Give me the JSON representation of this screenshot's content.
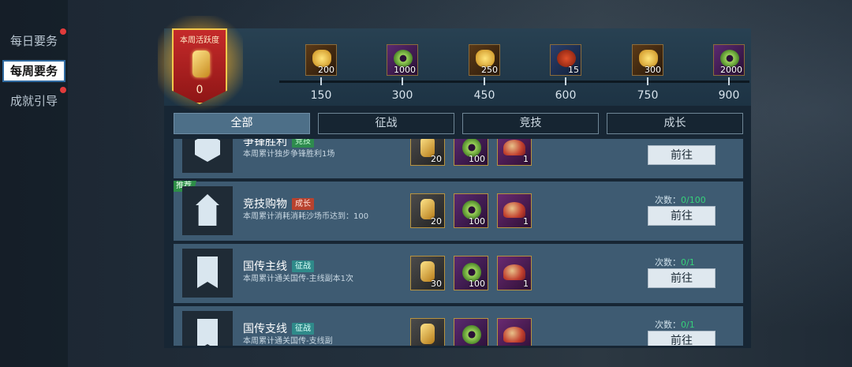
{
  "sidebar": {
    "items": [
      {
        "label": "每日要务",
        "active": false,
        "alert": true
      },
      {
        "label": "每周要务",
        "active": true,
        "alert": false
      },
      {
        "label": "成就引导",
        "active": false,
        "alert": true
      }
    ]
  },
  "badge": {
    "title": "本周活跃度",
    "value": "0"
  },
  "milestones": [
    {
      "threshold": "150",
      "count": "200",
      "icon": "gold-ingot-icon"
    },
    {
      "threshold": "300",
      "count": "1000",
      "icon": "jade-coin-icon"
    },
    {
      "threshold": "450",
      "count": "250",
      "icon": "gold-ingot-icon"
    },
    {
      "threshold": "600",
      "count": "15",
      "icon": "red-armor-icon"
    },
    {
      "threshold": "750",
      "count": "300",
      "icon": "gold-ingot-icon"
    },
    {
      "threshold": "900",
      "count": "2000",
      "icon": "jade-coin-icon"
    }
  ],
  "tabs": [
    {
      "label": "全部",
      "active": true
    },
    {
      "label": "征战",
      "active": false
    },
    {
      "label": "竞技",
      "active": false
    },
    {
      "label": "成长",
      "active": false
    }
  ],
  "tasks": [
    {
      "name": "争锋胜利",
      "tag": "竞技",
      "tag_color": "green",
      "desc": "本周累计独步争锋胜利1场",
      "rewards": [
        "20",
        "100",
        "1"
      ],
      "count_label": "",
      "count_value": "",
      "button": "前往",
      "recommended": false,
      "icon": "hex-emblem-icon"
    },
    {
      "name": "竞技购物",
      "tag": "成长",
      "tag_color": "red",
      "desc": "本周累计消耗消耗沙场币达到：100",
      "rewards": [
        "20",
        "100",
        "1"
      ],
      "count_label": "次数：",
      "count_value": "0/100",
      "button": "前往",
      "recommended": true,
      "recommend_label": "推荐",
      "icon": "shop-emblem-icon"
    },
    {
      "name": "国传主线",
      "tag": "征战",
      "tag_color": "teal",
      "desc": "本周累计通关国传-主线副本1次",
      "rewards": [
        "30",
        "100",
        "1"
      ],
      "count_label": "次数：",
      "count_value": "0/1",
      "button": "前往",
      "recommended": false,
      "icon": "banner-emblem-icon"
    },
    {
      "name": "国传支线",
      "tag": "征战",
      "tag_color": "teal",
      "desc": "本周累计通关国传-支线副",
      "rewards": [
        "",
        "",
        ""
      ],
      "count_label": "次数：",
      "count_value": "0/1",
      "button": "前往",
      "recommended": false,
      "icon": "banner-emblem-icon"
    }
  ],
  "colors": {
    "accent": "#4d6f88",
    "progress_green": "#36d17a",
    "badge_red": "#c52a2a"
  }
}
